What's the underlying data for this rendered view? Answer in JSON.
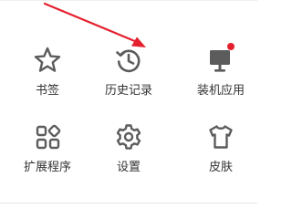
{
  "menu": {
    "items": [
      {
        "label": "书签",
        "icon": "star-icon"
      },
      {
        "label": "历史记录",
        "icon": "history-icon"
      },
      {
        "label": "装机应用",
        "icon": "monitor-icon",
        "badge": true
      },
      {
        "label": "扩展程序",
        "icon": "extensions-icon"
      },
      {
        "label": "设置",
        "icon": "gear-icon"
      },
      {
        "label": "皮肤",
        "icon": "tshirt-icon"
      }
    ]
  },
  "colors": {
    "icon": "#5c5c5c",
    "label": "#333333",
    "badge": "#e5202e",
    "annotation_arrow": "#e5202e"
  }
}
